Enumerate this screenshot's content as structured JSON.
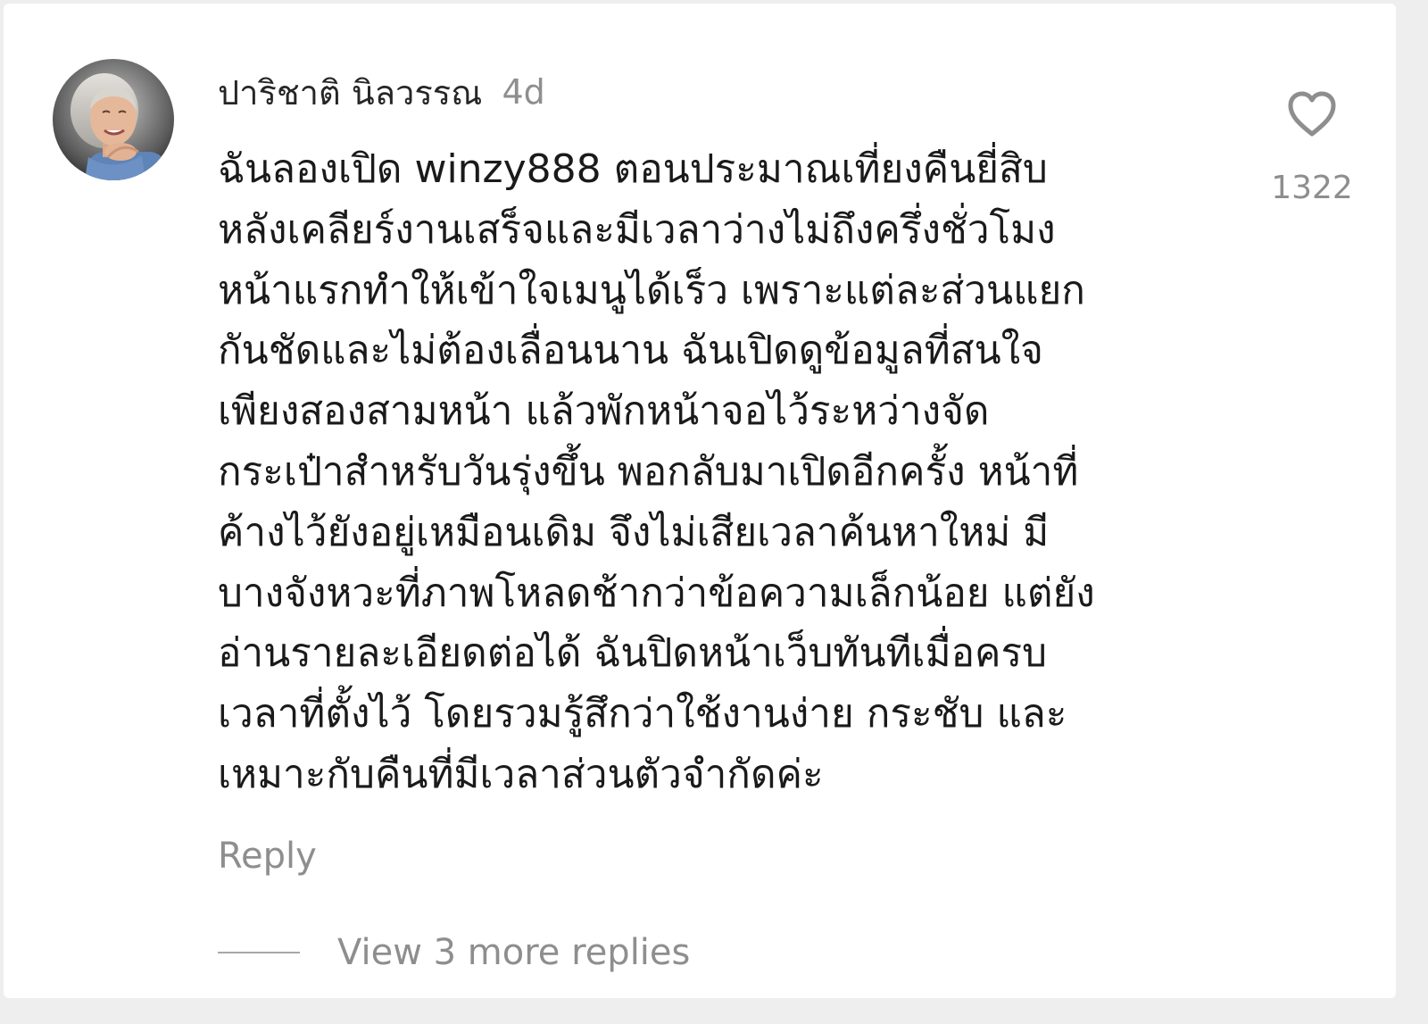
{
  "comment": {
    "author": "ปาริชาติ นิลวรรณ",
    "time_ago": "4d",
    "text_lines": [
      "ฉันลองเปิด winzy888 ตอนประมาณเที่ยงคืนยี่สิบ",
      "หลังเคลียร์งานเสร็จและมีเวลาว่างไม่ถึงครึ่งชั่วโมง",
      "หน้าแรกทำให้เข้าใจเมนูได้เร็ว เพราะแต่ละส่วนแยก",
      "กันชัดและไม่ต้องเลื่อนนาน ฉันเปิดดูข้อมูลที่สนใจ",
      "เพียงสองสามหน้า แล้วพักหน้าจอไว้ระหว่างจัด",
      "กระเป๋าสำหรับวันรุ่งขึ้น พอกลับมาเปิดอีกครั้ง หน้าที่",
      "ค้างไว้ยังอยู่เหมือนเดิม จึงไม่เสียเวลาค้นหาใหม่ มี",
      "บางจังหวะที่ภาพโหลดช้ากว่าข้อความเล็กน้อย แต่ยัง",
      "อ่านรายละเอียดต่อได้ ฉันปิดหน้าเว็บทันทีเมื่อครบ",
      "เวลาที่ตั้งไว้ โดยรวมรู้สึกว่าใช้งานง่าย กระชับ และ",
      "เหมาะกับคืนที่มีเวลาส่วนตัวจำกัดค่ะ"
    ],
    "like_count": "1322",
    "like_icon": "heart-outline-icon",
    "reply_label": "Reply",
    "view_replies_label": "View 3 more replies"
  },
  "colors": {
    "background": "#ffffff",
    "text_primary": "#262626",
    "text_secondary": "#8e8e8e"
  }
}
